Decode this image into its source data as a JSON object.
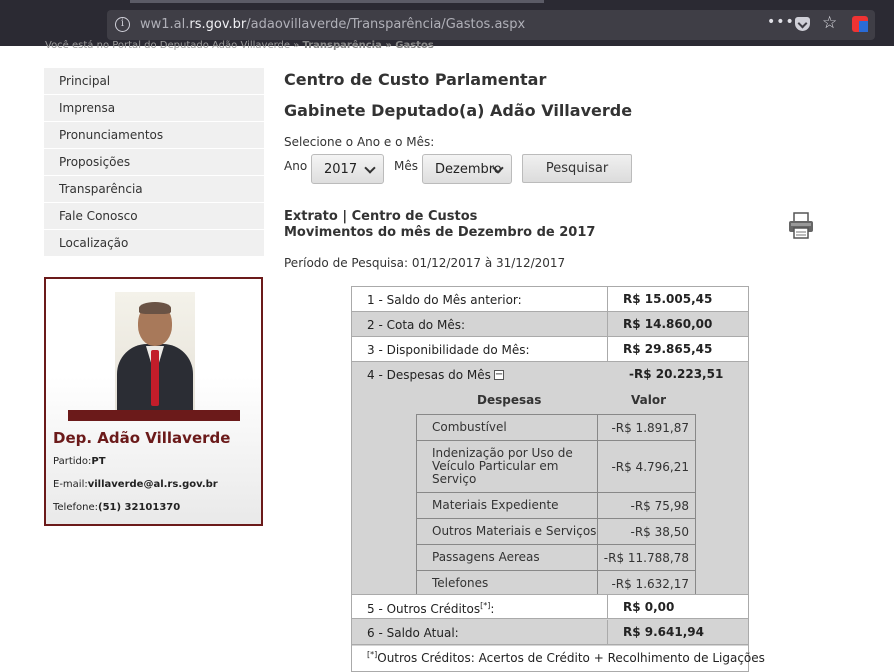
{
  "browser": {
    "url_prefix": "ww1.al.",
    "url_host": "rs.gov.br",
    "url_path": "/adaovillaverde/Transparência/Gastos.aspx",
    "menu_glyph": "•••"
  },
  "breadcrumb": {
    "text": "Você está no Portal do Deputado Adão Villaverde  »  ",
    "current": "Transparência » Gastos"
  },
  "sidebar": {
    "items": [
      "Principal",
      "Imprensa",
      "Pronunciamentos",
      "Proposições",
      "Transparência",
      "Fale Conosco",
      "Localização"
    ]
  },
  "profile": {
    "name": "Dep. Adão Villaverde",
    "partido_label": "Partido:",
    "partido": "PT",
    "email_label": "E-mail:",
    "email": "villaverde@al.rs.gov.br",
    "telefone_label": "Telefone:",
    "telefone": "(51) 32101370"
  },
  "main": {
    "title": "Centro de Custo Parlamentar",
    "subtitle": "Gabinete Deputado(a) Adão Villaverde",
    "select_prompt": "Selecione o Ano e o Mês:",
    "ano_label": "Ano",
    "ano_value": "2017",
    "mes_label": "Mês",
    "mes_value": "Dezembro",
    "search_button": "Pesquisar",
    "extrato_line1": "Extrato | Centro de Custos",
    "extrato_line2": "Movimentos do mês de Dezembro de 2017",
    "periodo": "Período de Pesquisa: 01/12/2017 à 31/12/2017"
  },
  "statement": {
    "rows": [
      {
        "label": "1 - Saldo do Mês anterior:",
        "value": "R$ 15.005,45"
      },
      {
        "label": "2 - Cota do Mês:",
        "value": "R$ 14.860,00"
      },
      {
        "label": "3 - Disponibilidade do Mês:",
        "value": "R$ 29.865,45"
      },
      {
        "label": "4 - Despesas do Mês",
        "value": "-R$ 20.223,51",
        "toggle": "−"
      },
      {
        "label": "5 - Outros Créditos",
        "sup": "[*]",
        "suffix": ":",
        "value": "R$ 0,00"
      },
      {
        "label": "6 - Saldo Atual:",
        "value": "R$ 9.641,94"
      }
    ],
    "despesas_header": "Despesas",
    "valor_header": "Valor",
    "despesas": [
      {
        "name": "Combustível",
        "value": "-R$ 1.891,87"
      },
      {
        "name": "Indenização por Uso de Veículo Particular em Serviço",
        "value": "-R$ 4.796,21"
      },
      {
        "name": "Materiais Expediente",
        "value": "-R$ 75,98"
      },
      {
        "name": "Outros Materiais e Serviços",
        "value": "-R$ 38,50"
      },
      {
        "name": "Passagens Aereas",
        "value": "-R$ 11.788,78"
      },
      {
        "name": "Telefones",
        "value": "-R$ 1.632,17"
      }
    ],
    "footnote_mark": "[*]",
    "footnote": "Outros Créditos: Acertos de Crédito + Recolhimento de Ligações"
  }
}
